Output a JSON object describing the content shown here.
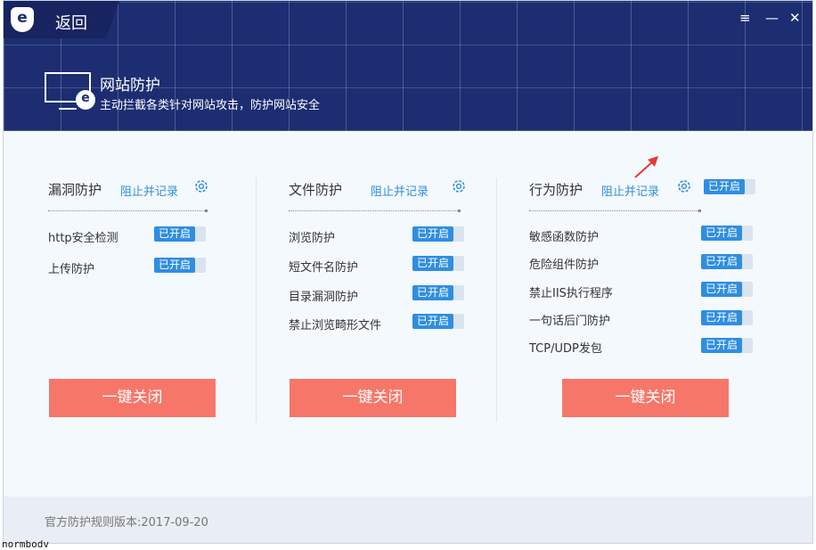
{
  "header": {
    "back_label": "返回",
    "title": "网站防护",
    "subtitle": "主动拦截各类针对网站攻击，防护网站安全",
    "logo_letter": "e",
    "menu_icon": "≡",
    "minimize_icon": "—",
    "close_icon": "✕"
  },
  "sections": [
    {
      "title": "漏洞防护",
      "mode": "阻止并记录",
      "items": [
        {
          "label": "http安全检测",
          "status": "已开启"
        },
        {
          "label": "上传防护",
          "status": "已开启"
        }
      ],
      "button": "一键关闭"
    },
    {
      "title": "文件防护",
      "mode": "阻止并记录",
      "items": [
        {
          "label": "浏览防护",
          "status": "已开启"
        },
        {
          "label": "短文件名防护",
          "status": "已开启"
        },
        {
          "label": "目录漏洞防护",
          "status": "已开启"
        },
        {
          "label": "禁止浏览畸形文件",
          "status": "已开启"
        }
      ],
      "button": "一键关闭"
    },
    {
      "title": "行为防护",
      "mode": "阻止并记录",
      "master_status": "已开启",
      "items": [
        {
          "label": "敏感函数防护",
          "status": "已开启"
        },
        {
          "label": "危险组件防护",
          "status": "已开启"
        },
        {
          "label": "禁止IIS执行程序",
          "status": "已开启"
        },
        {
          "label": "一句话后门防护",
          "status": "已开启"
        },
        {
          "label": "TCP/UDP发包",
          "status": "已开启"
        }
      ],
      "button": "一键关闭"
    }
  ],
  "footer": {
    "version_text": "官方防护规则版本:2017-09-20"
  },
  "outside_text": "normbodv",
  "colors": {
    "header_bg": "#1c2d72",
    "accent_blue": "#2f8ee0",
    "button_red": "#f6776a",
    "annotation_arrow": "#e53935"
  },
  "icons": [
    "logo-icon",
    "menu-icon",
    "minimize-icon",
    "close-icon",
    "monitor-icon",
    "gear-icon",
    "annotation-arrow-icon"
  ]
}
